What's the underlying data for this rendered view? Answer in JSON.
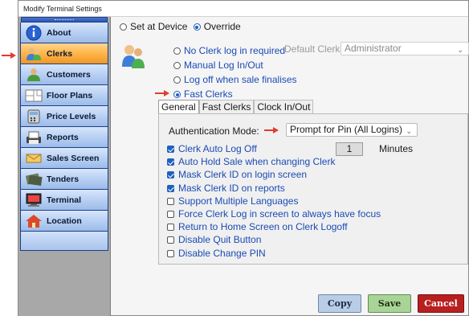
{
  "window": {
    "title": "Modify Terminal Settings"
  },
  "sidebar": {
    "items": [
      {
        "label": "About",
        "icon": "info-icon",
        "active": false
      },
      {
        "label": "Clerks",
        "icon": "clerks-icon",
        "active": true
      },
      {
        "label": "Customers",
        "icon": "customers-icon",
        "active": false
      },
      {
        "label": "Floor Plans",
        "icon": "floor-plans-icon",
        "active": false
      },
      {
        "label": "Price Levels",
        "icon": "price-levels-icon",
        "active": false
      },
      {
        "label": "Reports",
        "icon": "reports-icon",
        "active": false
      },
      {
        "label": "Sales Screen",
        "icon": "sales-screen-icon",
        "active": false
      },
      {
        "label": "Tenders",
        "icon": "tenders-icon",
        "active": false
      },
      {
        "label": "Terminal",
        "icon": "terminal-icon",
        "active": false
      },
      {
        "label": "Location",
        "icon": "location-icon",
        "active": false
      }
    ]
  },
  "main": {
    "scope": {
      "set_at_device": "Set at Device",
      "override": "Override",
      "selected": "override"
    },
    "login_options": {
      "no_clerk_log": "No Clerk log in required",
      "manual_log": "Manual Log In/Out",
      "log_off_finalise": "Log off when sale finalises",
      "fast_clerks": "Fast Clerks",
      "selected": "fast_clerks"
    },
    "default_clerk": {
      "label": "Default Clerk:",
      "value": "Administrator"
    },
    "tabs": [
      {
        "label": "General",
        "active": true
      },
      {
        "label": "Fast Clerks",
        "active": false
      },
      {
        "label": "Clock In/Out",
        "active": false
      }
    ],
    "general": {
      "auth_mode_label": "Authentication Mode:",
      "auth_mode_value": "Prompt for Pin (All Logins)",
      "minutes_value": "1",
      "minutes_label": "Minutes",
      "options": [
        {
          "label": "Clerk Auto Log Off",
          "checked": true
        },
        {
          "label": "Auto Hold Sale when changing Clerk",
          "checked": true
        },
        {
          "label": "Mask Clerk ID on login screen",
          "checked": true
        },
        {
          "label": "Mask Clerk ID on reports",
          "checked": true
        },
        {
          "label": "Support Multiple Languages",
          "checked": false
        },
        {
          "label": "Force Clerk Log in screen to always have focus",
          "checked": false
        },
        {
          "label": "Return to Home Screen on Clerk Logoff",
          "checked": false
        },
        {
          "label": "Disable Quit Button",
          "checked": false
        },
        {
          "label": "Disable Change PIN",
          "checked": false
        }
      ]
    }
  },
  "buttons": {
    "copy": "Copy",
    "save": "Save",
    "cancel": "Cancel"
  },
  "colors": {
    "accent_blue": "#1f5fbf",
    "arrow_red": "#e23b2e",
    "active_nav": "#ffb548"
  }
}
